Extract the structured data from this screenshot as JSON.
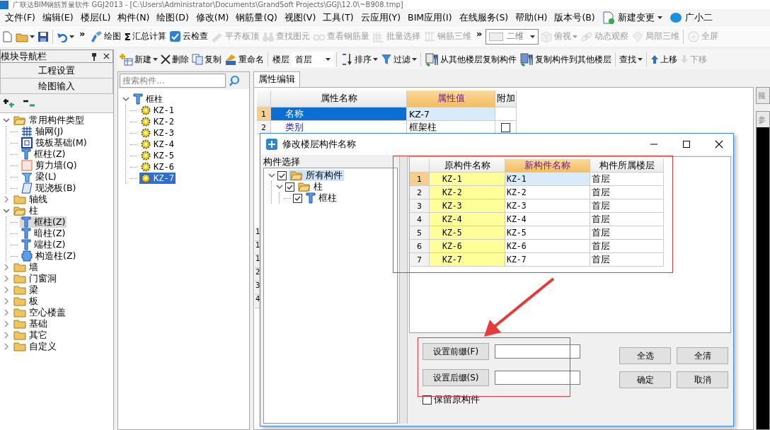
{
  "window": {
    "title": "广联达BIM钢筋算量软件 GGJ2013 - [C:\\Users\\Administrator\\Documents\\GrandSoft Projects\\GGJ\\12.0\\~B908.tmp]"
  },
  "menu": [
    {
      "label": "文件(F)"
    },
    {
      "label": "编辑(E)"
    },
    {
      "label": "楼层(L)"
    },
    {
      "label": "构件(N)"
    },
    {
      "label": "绘图(D)"
    },
    {
      "label": "修改(M)"
    },
    {
      "label": "钢筋量(Q)"
    },
    {
      "label": "视图(V)"
    },
    {
      "label": "工具(T)"
    },
    {
      "label": "云应用(Y)"
    },
    {
      "label": "BIM应用(I)"
    },
    {
      "label": "在线服务(S)"
    },
    {
      "label": "帮助(H)"
    },
    {
      "label": "版本号(B)"
    },
    {
      "label": "新建变更",
      "kind": "change",
      "dropdown": true
    },
    {
      "label": "广小二",
      "kind": "assistant",
      "dropdown": false
    }
  ],
  "toolbar": [
    {
      "kind": "file",
      "disabled": false,
      "dropdown": false
    },
    {
      "kind": "open",
      "disabled": false,
      "dropdown": true
    },
    {
      "kind": "save",
      "disabled": false,
      "dropdown": false
    },
    {
      "kind": "separator"
    },
    {
      "kind": "undo",
      "disabled": false,
      "dropdown": true
    },
    {
      "kind": "overflow",
      "label": "»"
    },
    {
      "kind": "draw",
      "label": "绘图",
      "disabled": false,
      "dropdown": false
    },
    {
      "kind": "sigma",
      "icon": "Σ",
      "label": "汇总计算",
      "disabled": false,
      "dropdown": false
    },
    {
      "kind": "cloud",
      "label": "云检查",
      "disabled": false,
      "dropdown": false
    },
    {
      "kind": "level",
      "label": "平齐板顶",
      "disabled": true,
      "dropdown": false
    },
    {
      "kind": "find",
      "label": "查找图元",
      "disabled": true,
      "dropdown": false
    },
    {
      "kind": "view",
      "label": "查看钢筋量",
      "disabled": true,
      "dropdown": false
    },
    {
      "kind": "batch",
      "label": "批量选择",
      "disabled": true,
      "dropdown": false
    },
    {
      "kind": "rebar3d",
      "label": "钢筋三维",
      "disabled": true,
      "dropdown": false
    },
    {
      "kind": "overflow",
      "label": "»"
    },
    {
      "kind": "combo",
      "label": "二维"
    },
    {
      "kind": "top",
      "label": "俯视",
      "disabled": true,
      "dropdown": true
    },
    {
      "kind": "orbit",
      "label": "动态观察",
      "disabled": true,
      "dropdown": false
    },
    {
      "kind": "local3d",
      "label": "局部三维",
      "disabled": true,
      "dropdown": false
    },
    {
      "kind": "separator"
    },
    {
      "kind": "fullscreen",
      "label": "全屏",
      "disabled": true,
      "dropdown": false
    }
  ],
  "nav": {
    "title": "模块导航栏",
    "sections": [
      {
        "label": "工程设置"
      },
      {
        "label": "绘图输入"
      }
    ],
    "tree": [
      {
        "label": "常用构件类型",
        "kind": "folder",
        "expanded": true,
        "selected": false,
        "children": [
          {
            "label": "轴网(J)",
            "kind": "grid",
            "selected": false
          },
          {
            "label": "筏板基础(M)",
            "kind": "raft",
            "selected": false
          },
          {
            "label": "框柱(Z)",
            "kind": "column",
            "selected": false
          },
          {
            "label": "剪力墙(Q)",
            "kind": "wall",
            "selected": false
          },
          {
            "label": "梁(L)",
            "kind": "beam",
            "selected": false
          },
          {
            "label": "现浇板(B)",
            "kind": "slab",
            "selected": false
          }
        ]
      },
      {
        "label": "轴线",
        "kind": "folder",
        "expanded": false,
        "selected": false
      },
      {
        "label": "柱",
        "kind": "folder",
        "expanded": true,
        "selected": false,
        "children": [
          {
            "label": "框柱(Z)",
            "kind": "column",
            "selected": true
          },
          {
            "label": "暗柱(Z)",
            "kind": "column",
            "selected": false
          },
          {
            "label": "端柱(Z)",
            "kind": "column",
            "selected": false
          },
          {
            "label": "构造柱(Z)",
            "kind": "structural",
            "selected": false
          }
        ]
      },
      {
        "label": "墙",
        "kind": "folder",
        "expanded": false,
        "selected": false
      },
      {
        "label": "门窗洞",
        "kind": "folder",
        "expanded": false,
        "selected": false
      },
      {
        "label": "梁",
        "kind": "folder",
        "expanded": false,
        "selected": false
      },
      {
        "label": "板",
        "kind": "folder",
        "expanded": false,
        "selected": false
      },
      {
        "label": "空心楼盖",
        "kind": "folder",
        "expanded": false,
        "selected": false
      },
      {
        "label": "基础",
        "kind": "folder",
        "expanded": false,
        "selected": false
      },
      {
        "label": "其它",
        "kind": "folder",
        "expanded": false,
        "selected": false
      },
      {
        "label": "自定义",
        "kind": "folder",
        "expanded": false,
        "selected": false
      }
    ]
  },
  "toolbar2": [
    {
      "kind": "new",
      "label": "新建",
      "disabled": false,
      "dropdown": true
    },
    {
      "kind": "delete",
      "label": "删除",
      "disabled": false,
      "dropdown": false
    },
    {
      "kind": "copy",
      "label": "复制",
      "disabled": false,
      "dropdown": false
    },
    {
      "kind": "rename",
      "label": "重命名",
      "disabled": false,
      "dropdown": false
    },
    {
      "kind": "separator"
    },
    {
      "kind": "label",
      "label": "楼层"
    },
    {
      "kind": "combo",
      "label": "首层"
    },
    {
      "kind": "separator"
    },
    {
      "kind": "sort",
      "label": "排序",
      "disabled": false,
      "dropdown": true
    },
    {
      "kind": "filter",
      "label": "过滤",
      "disabled": false,
      "dropdown": true
    },
    {
      "kind": "separator"
    },
    {
      "kind": "copy-from",
      "label": "从其他楼层复制构件",
      "disabled": false,
      "dropdown": false
    },
    {
      "kind": "copy-to",
      "label": "复制构件到其他楼层",
      "disabled": false,
      "dropdown": false
    },
    {
      "kind": "separator"
    },
    {
      "kind": "text",
      "label": "查找",
      "disabled": false,
      "dropdown": true
    },
    {
      "kind": "separator"
    },
    {
      "kind": "up",
      "label": "上移",
      "disabled": false,
      "dropdown": false
    },
    {
      "kind": "down",
      "label": "下移",
      "disabled": true,
      "dropdown": false
    }
  ],
  "components": {
    "search": {
      "placeholder": "搜索构件..."
    },
    "tree": [
      {
        "label": "框柱",
        "kind": "column",
        "expanded": true,
        "selected": false,
        "children": [
          {
            "label": "KZ-1",
            "kind": "component",
            "selected": false
          },
          {
            "label": "KZ-2",
            "kind": "component",
            "selected": false
          },
          {
            "label": "KZ-3",
            "kind": "component",
            "selected": false
          },
          {
            "label": "KZ-4",
            "kind": "component",
            "selected": false
          },
          {
            "label": "KZ-5",
            "kind": "component",
            "selected": false
          },
          {
            "label": "KZ-6",
            "kind": "component",
            "selected": false
          },
          {
            "label": "KZ-7",
            "kind": "component",
            "selected": true
          }
        ]
      }
    ]
  },
  "properties": {
    "tab": "属性编辑",
    "columns": [
      "属性名称",
      "属性值",
      "附加"
    ],
    "rows": [
      {
        "number": "1",
        "name": "名称",
        "value": "KZ-7",
        "selected": true
      },
      {
        "number": "2",
        "name": "类别",
        "value": "框架柱",
        "selected": false,
        "extra": {
          "checked": false
        }
      }
    ],
    "hidden_row_numbers": [
      "1",
      "1",
      "1",
      "2",
      "3",
      "4"
    ]
  },
  "side_panels": [
    {
      "label": "箍"
    },
    {
      "label": "参"
    }
  ],
  "dialog": {
    "title": "修改楼层构件名称",
    "tree_label": "构件选择",
    "tree": [
      {
        "label": "所有构件",
        "kind": "folder",
        "checked": true,
        "expanded": true,
        "selected": true,
        "children": [
          {
            "label": "柱",
            "kind": "folder",
            "checked": true,
            "expanded": true,
            "selected": false,
            "children": [
              {
                "label": "框柱",
                "kind": "column",
                "checked": true,
                "selected": false
              }
            ]
          }
        ]
      }
    ],
    "columns": [
      "原构件名称",
      "新构件名称",
      "构件所属楼层"
    ],
    "rows": [
      {
        "number": "1",
        "original": "KZ-1",
        "new": "KZ-1",
        "floor": "首层",
        "selected": true
      },
      {
        "number": "2",
        "original": "KZ-2",
        "new": "KZ-2",
        "floor": "首层",
        "selected": false
      },
      {
        "number": "3",
        "original": "KZ-3",
        "new": "KZ-3",
        "floor": "首层",
        "selected": false
      },
      {
        "number": "4",
        "original": "KZ-4",
        "new": "KZ-4",
        "floor": "首层",
        "selected": false
      },
      {
        "number": "5",
        "original": "KZ-5",
        "new": "KZ-5",
        "floor": "首层",
        "selected": false
      },
      {
        "number": "6",
        "original": "KZ-6",
        "new": "KZ-6",
        "floor": "首层",
        "selected": false
      },
      {
        "number": "7",
        "original": "KZ-7",
        "new": "KZ-7",
        "floor": "首层",
        "selected": false
      }
    ],
    "prefix_button": "设置前缀(F)",
    "suffix_button": "设置后缀(S)",
    "buttons": [
      "全选",
      "全清",
      "确定",
      "取消"
    ],
    "keep_original": {
      "label": "保留原构件",
      "checked": false
    }
  }
}
